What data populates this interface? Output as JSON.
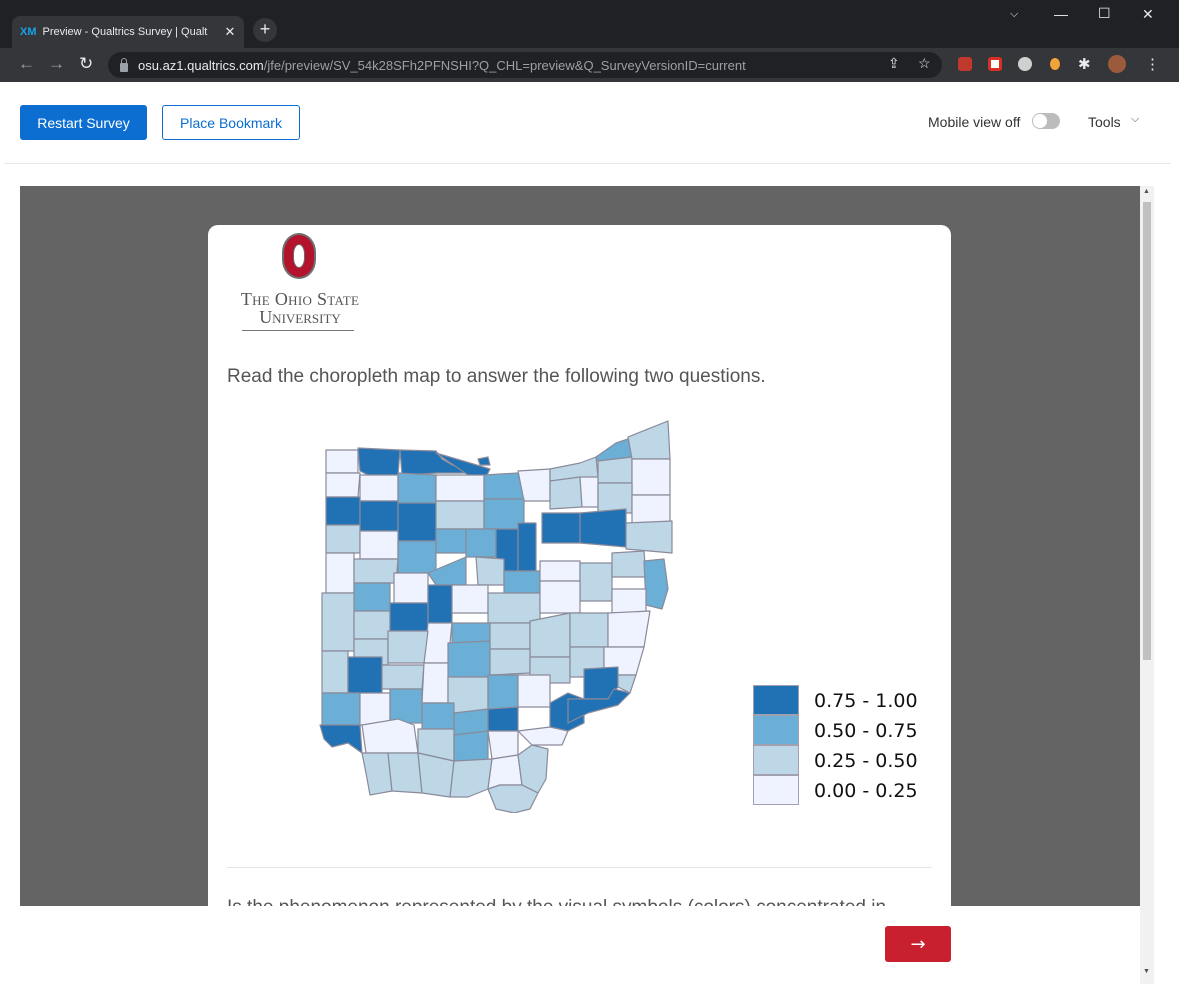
{
  "browser": {
    "tab_title": "Preview - Qualtrics Survey | Qualt",
    "tab_logo": "XM",
    "url_host": "osu.az1.qualtrics.com",
    "url_path": "/jfe/preview/SV_54k28SFh2PFNSHI?Q_CHL=preview&Q_SurveyVersionID=current"
  },
  "toolbar": {
    "restart_label": "Restart Survey",
    "bookmark_label": "Place Bookmark",
    "mobile_label": "Mobile view off",
    "mobile_view_on": false,
    "tools_label": "Tools"
  },
  "survey": {
    "logo_line1": "The Ohio State",
    "logo_line2": "University",
    "question": "Read the choropleth map to answer the following two questions.",
    "next_question_partial": "Is the phenomenon represented by the visual symbols (colors) concentrated in",
    "next_button": "→"
  },
  "map": {
    "colors": [
      "#eff3ff",
      "#bdd7e7",
      "#6baed6",
      "#2171b5"
    ],
    "border_color": "#8a8a9a",
    "legend": [
      {
        "label": "0.75 - 1.00",
        "color": "#2171b5"
      },
      {
        "label": "0.50 - 0.75",
        "color": "#6baed6"
      },
      {
        "label": "0.25 - 0.50",
        "color": "#bdd7e7"
      },
      {
        "label": "0.00 - 0.25",
        "color": "#eff3ff"
      }
    ]
  }
}
